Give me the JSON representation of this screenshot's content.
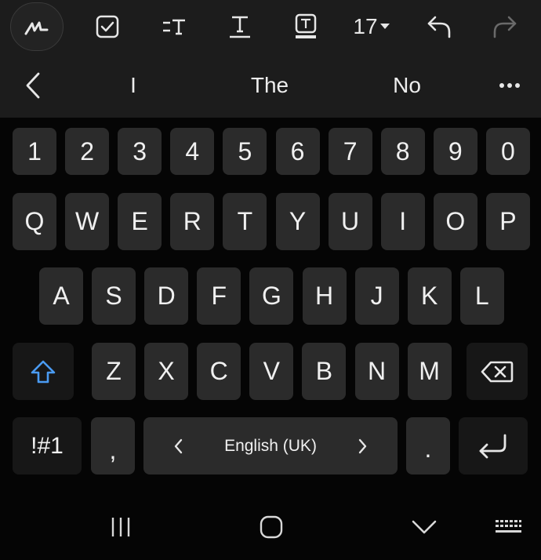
{
  "toolbar": {
    "items": [
      {
        "icon": "handwriting-pen-icon"
      },
      {
        "icon": "checkbox-icon"
      },
      {
        "icon": "text-style-icon"
      },
      {
        "icon": "underline-text-icon"
      },
      {
        "icon": "text-box-icon"
      },
      {
        "label": "17",
        "icon": "caret-down-icon"
      },
      {
        "icon": "undo-icon"
      },
      {
        "icon": "redo-icon"
      }
    ]
  },
  "suggestions": {
    "back_icon": "chevron-left-icon",
    "words": [
      "I",
      "The",
      "No"
    ],
    "more_icon": "more-dots-icon"
  },
  "keyboard": {
    "row_numbers": [
      "1",
      "2",
      "3",
      "4",
      "5",
      "6",
      "7",
      "8",
      "9",
      "0"
    ],
    "row_top": [
      "Q",
      "W",
      "E",
      "R",
      "T",
      "Y",
      "U",
      "I",
      "O",
      "P"
    ],
    "row_home": [
      "A",
      "S",
      "D",
      "F",
      "G",
      "H",
      "J",
      "K",
      "L"
    ],
    "row_bottom": [
      "Z",
      "X",
      "C",
      "V",
      "B",
      "N",
      "M"
    ],
    "shift_icon": "shift-arrow-icon",
    "backspace_icon": "backspace-icon",
    "symbols_label": "!#1",
    "comma_label": ",",
    "space_label": "English (UK)",
    "period_label": ".",
    "enter_icon": "enter-icon"
  },
  "navbar": {
    "items": [
      "recent-apps-icon",
      "home-icon",
      "hide-keyboard-icon",
      "keyboard-switch-icon"
    ]
  },
  "colors": {
    "accent": "#4a9bf2",
    "key": "#2b2b2b",
    "function_key": "#171717",
    "toolbar": "#1c1c1c",
    "background": "#050505"
  }
}
